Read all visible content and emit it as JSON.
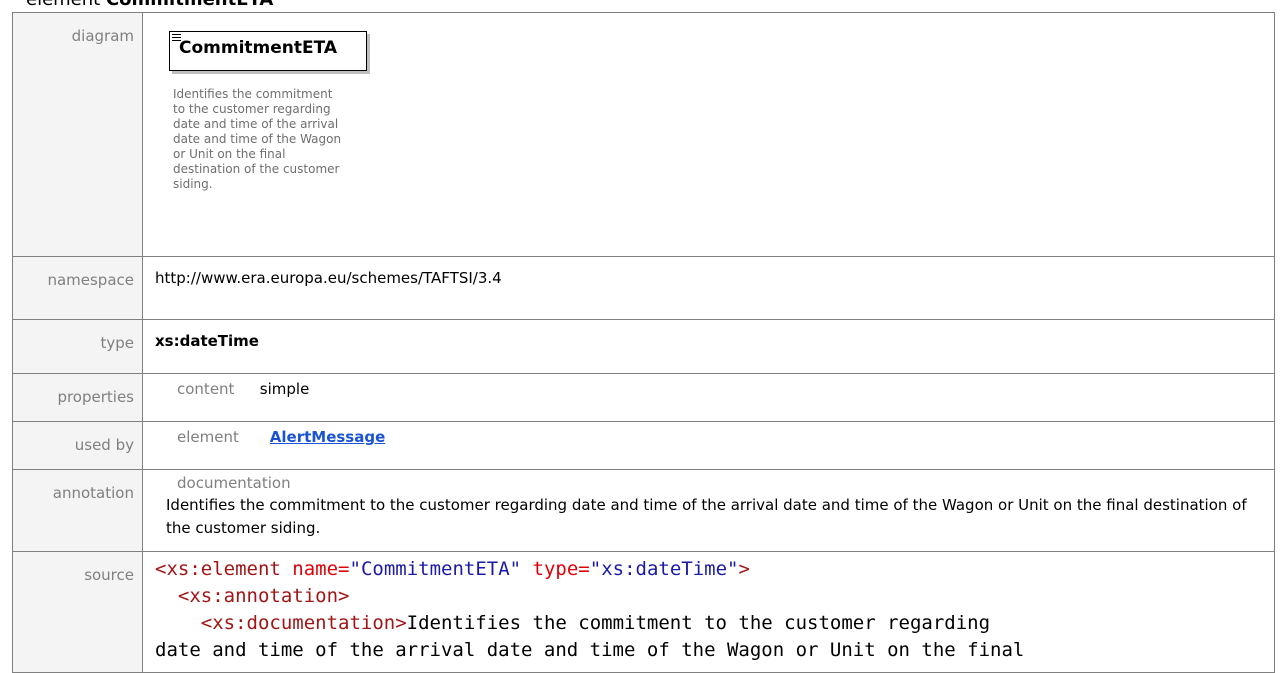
{
  "heading": {
    "prefix": "element",
    "name": "CommitmentETA"
  },
  "labels": {
    "diagram": "diagram",
    "namespace": "namespace",
    "type": "type",
    "properties": "properties",
    "used_by": "used by",
    "annotation": "annotation",
    "source": "source"
  },
  "diagram": {
    "element_name": "CommitmentETA",
    "description": "Identifies the commitment to the customer regarding date and time of the arrival date and time of the Wagon or Unit on the final destination of the customer siding."
  },
  "namespace": "http://www.era.europa.eu/schemes/TAFTSI/3.4",
  "type": "xs:dateTime",
  "properties": {
    "key": "content",
    "value": "simple"
  },
  "used_by": {
    "kind": "element",
    "link": "AlertMessage"
  },
  "annotation": {
    "heading": "documentation",
    "text": "Identifies the commitment to the customer regarding date and time of the arrival date and time of the Wagon or Unit on the final destination of the customer siding."
  },
  "source": {
    "line1_tag": "<xs:element",
    "line1_attr1": "name=",
    "line1_val1": "\"CommitmentETA\"",
    "line1_attr2": "type=",
    "line1_val2": "\"xs:dateTime\"",
    "line1_end": ">",
    "line2_tag": "<xs:annotation>",
    "line3_tag": "<xs:documentation>",
    "line3_text": "Identifies the commitment to the customer regarding",
    "line4_text": "date and time of the arrival date and time of the Wagon or Unit on the final"
  }
}
